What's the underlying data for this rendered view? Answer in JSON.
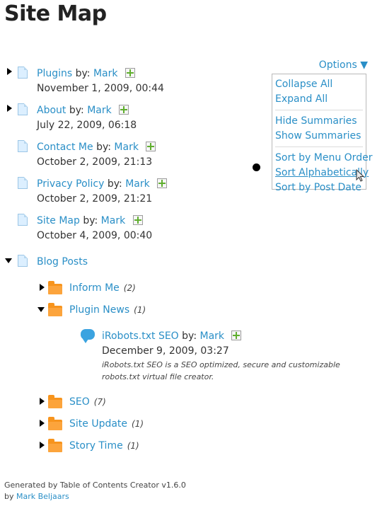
{
  "title": "Site Map",
  "by_label": "by:",
  "author": "Mark",
  "pages": [
    {
      "name": "Plugins",
      "date": "November 1, 2009, 00:44"
    },
    {
      "name": "About",
      "date": "July 22, 2009, 06:18"
    },
    {
      "name": "Contact Me",
      "date": "October 2, 2009, 21:13"
    },
    {
      "name": "Privacy Policy",
      "date": "October 2, 2009, 21:21"
    },
    {
      "name": "Site Map",
      "date": "October 4, 2009, 00:40"
    }
  ],
  "blog": {
    "label": "Blog Posts",
    "categories": [
      {
        "name": "Inform Me",
        "count": "(2)"
      },
      {
        "name": "Plugin News",
        "count": "(1)"
      },
      {
        "name": "SEO",
        "count": "(7)"
      },
      {
        "name": "Site Update",
        "count": "(1)"
      },
      {
        "name": "Story Time",
        "count": "(1)"
      }
    ],
    "post": {
      "name": "iRobots.txt SEO",
      "date": "December 9, 2009, 03:27",
      "summary": "iRobots.txt SEO is a SEO optimized, secure and customizable robots.txt virtual file creator."
    }
  },
  "options": {
    "label": "Options ▼",
    "items": [
      "Collapse All",
      "Expand All",
      "Hide Summaries",
      "Show Summaries",
      "Sort by Menu Order",
      "Sort Alphabetically",
      "Sort by Post Date"
    ]
  },
  "footer": {
    "line1": "Generated by Table of Contents Creator v1.6.0",
    "line2_prefix": "by",
    "line2_link": "Mark Beljaars"
  },
  "colors": {
    "link": "#2a8fc7",
    "folder": "#f7941d",
    "plus": "#5fae2e"
  }
}
